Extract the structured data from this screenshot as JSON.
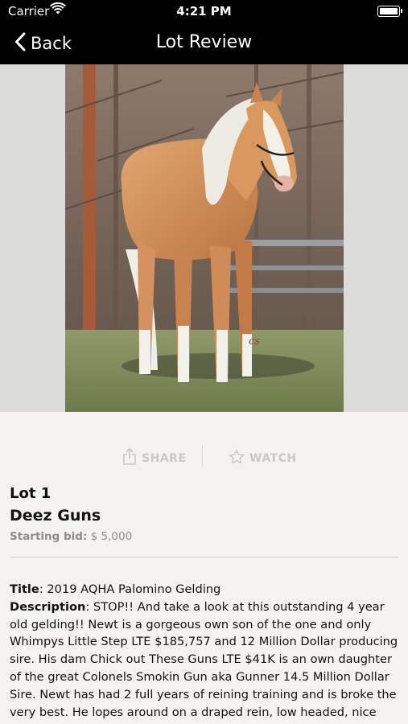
{
  "status_bar": {
    "carrier": "Carrier",
    "time": "4:21 PM"
  },
  "nav": {
    "back_label": "Back",
    "title": "Lot Review"
  },
  "actions": {
    "share_label": "SHARE",
    "watch_label": "WATCH"
  },
  "lot": {
    "number": "Lot 1",
    "name": "Deez Guns",
    "starting_bid_label": "Starting bid:",
    "starting_bid_value": "$ 5,000"
  },
  "details": {
    "title_label": "Title",
    "title_value": ": 2019 AQHA Palomino Gelding",
    "description_label": "Description",
    "description_value": ": STOP!! And take a look at this outstanding 4 year old gelding!! Newt is a gorgeous own son of the one and only Whimpys Little Step LTE $185,757 and 12 Million Dollar producing sire. His dam Chick out These Guns LTE $41K is an own daughter of the great Colonels Smokin Gun aka Gunner 14.5 Million Dollar Sire. Newt has had 2 full years of reining training and is broke the very best. He lopes around on a draped rein, low headed, nice speed transitions,"
  },
  "colors": {
    "nav_background": "#000000",
    "page_background": "#f4f3f0",
    "action_gray": "#c9c8c4",
    "bid_gray": "#8e8d89"
  },
  "icons": {
    "wifi": "wifi-icon",
    "battery": "battery-icon",
    "back": "chevron-left-icon",
    "share": "share-icon",
    "watch": "star-icon"
  }
}
